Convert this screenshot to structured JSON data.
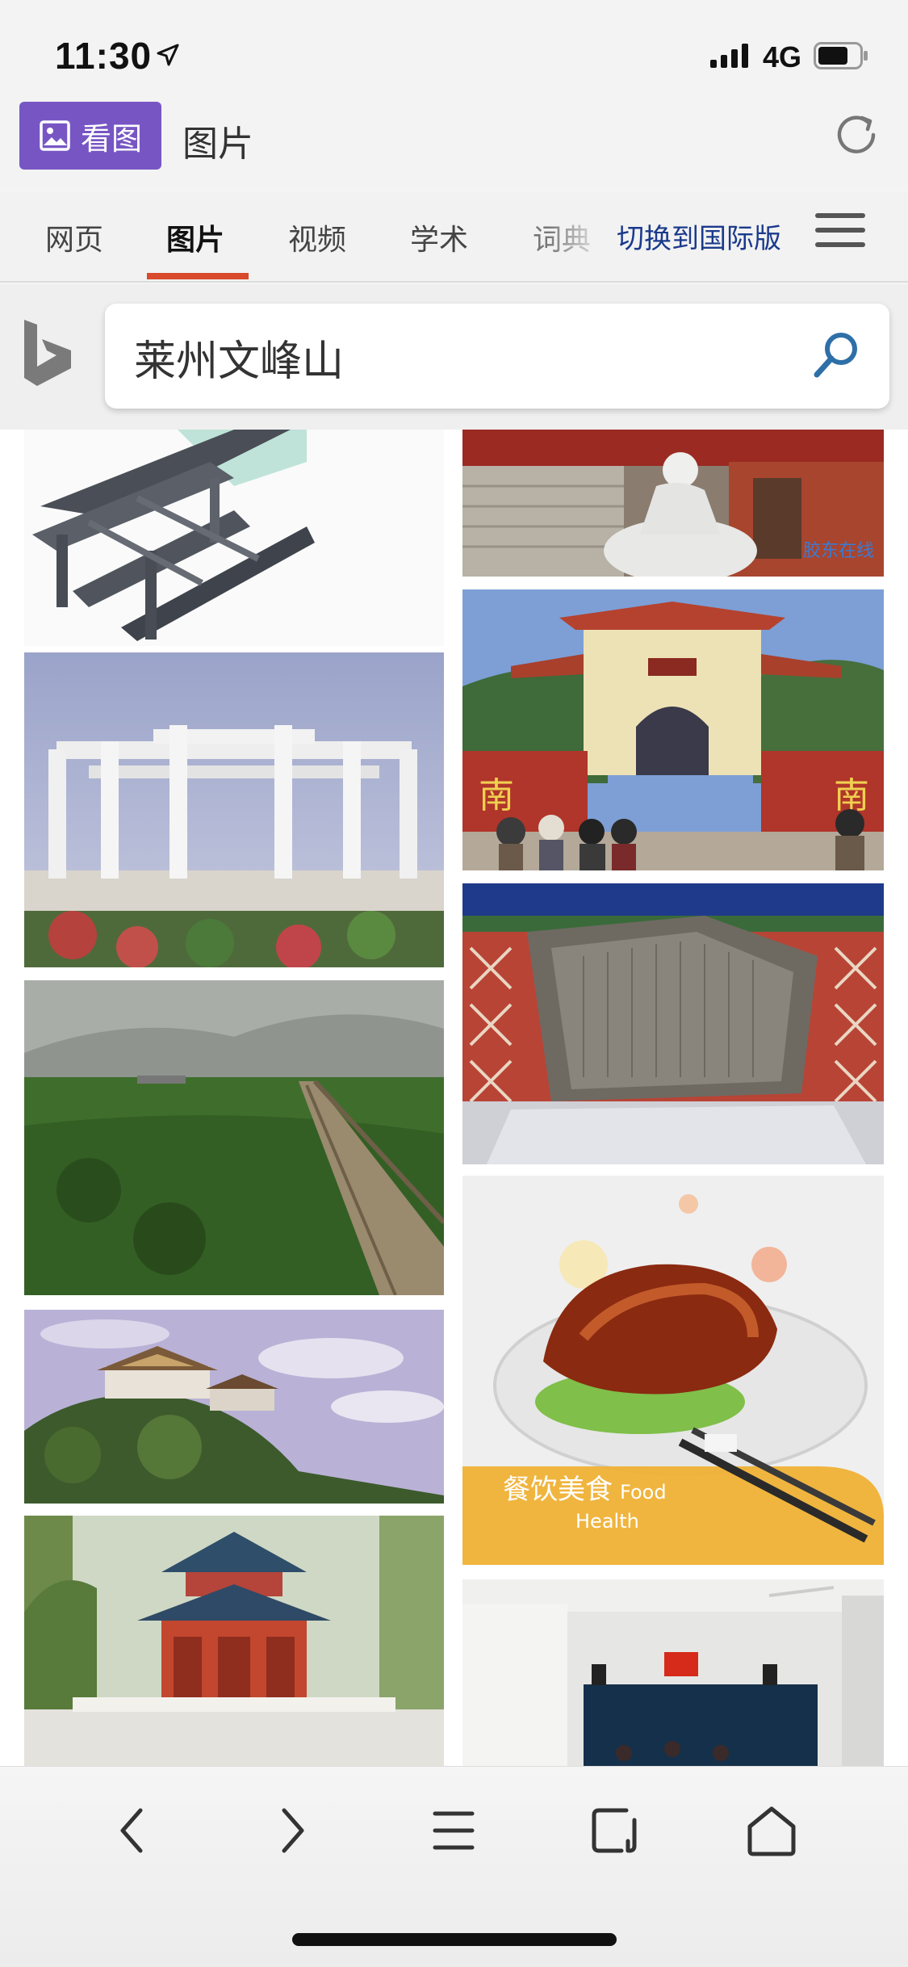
{
  "status_bar": {
    "time": "11:30",
    "network": "4G"
  },
  "header": {
    "kantu_label": "看图",
    "page_title": "图片"
  },
  "tabs": [
    {
      "label": "网页",
      "active": false
    },
    {
      "label": "图片",
      "active": true
    },
    {
      "label": "视频",
      "active": false
    },
    {
      "label": "学术",
      "active": false
    },
    {
      "label": "词典",
      "active": false
    }
  ],
  "switch_international": "切换到国际版",
  "search": {
    "query": "莱州文峰山"
  },
  "images": {
    "statue_watermark": "胶东在线",
    "gate_sign_left": "南",
    "gate_sign_right": "南",
    "food_caption_cn": "餐饮美食",
    "food_caption_en1": "Food",
    "food_caption_en2": "Health"
  },
  "colors": {
    "accent_purple": "#7756c4",
    "tab_underline": "#d84a2b",
    "intl_link": "#1b3a8c",
    "search_icon": "#2e6fa8"
  },
  "icons": {
    "back": "chevron-left-icon",
    "forward": "chevron-right-icon",
    "menu": "menu-icon",
    "tabs": "tabs-icon",
    "home": "home-icon"
  }
}
